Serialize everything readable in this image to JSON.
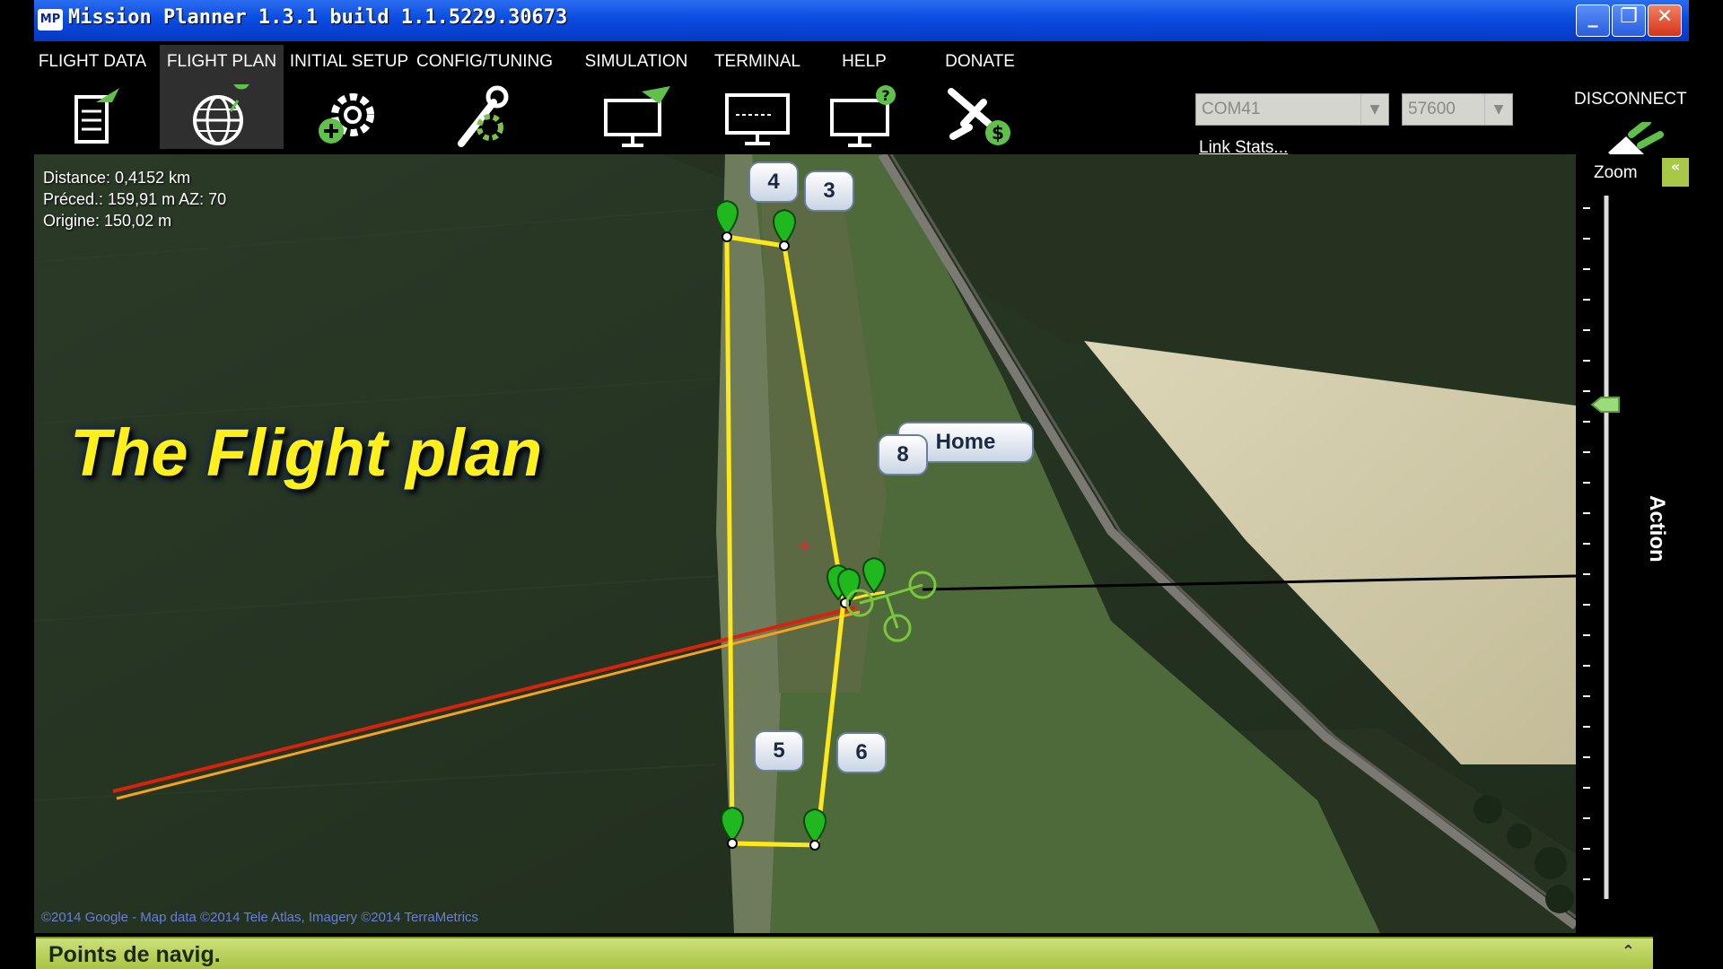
{
  "title_bar": {
    "app_icon_text": "MP",
    "title": "Mission Planner 1.3.1 build 1.1.5229.30673"
  },
  "menu": [
    {
      "label": "FLIGHT DATA",
      "icon": "clipboard-plane-icon",
      "active": false
    },
    {
      "label": "FLIGHT PLAN",
      "icon": "globe-pin-icon",
      "active": true
    },
    {
      "label": "INITIAL SETUP",
      "icon": "gear-plus-icon",
      "active": false
    },
    {
      "label": "CONFIG/TUNING",
      "icon": "wrench-gear-icon",
      "active": false
    },
    {
      "label": "SIMULATION",
      "icon": "monitor-plane-icon",
      "active": false
    },
    {
      "label": "TERMINAL",
      "icon": "terminal-monitor-icon",
      "active": false
    },
    {
      "label": "HELP",
      "icon": "monitor-help-icon",
      "active": false
    },
    {
      "label": "DONATE",
      "icon": "plane-dollar-icon",
      "active": false
    }
  ],
  "connection": {
    "port": "COM41",
    "baud": "57600",
    "link_stats": "Link Stats...",
    "disconnect": "DISCONNECT"
  },
  "map": {
    "distance": "Distance: 0,4152 km",
    "previous": "Préced.: 159,91 m AZ: 70",
    "home_dist": "Origine: 150,02 m",
    "overlay_title": "The Flight plan",
    "copyright": "©2014 Google - Map data ©2014 Tele Atlas, Imagery ©2014 TerraMetrics",
    "waypoint_labels": {
      "wp3": "3",
      "wp4": "4",
      "wp5": "5",
      "wp6": "6",
      "wp8": "8",
      "home": "Home"
    }
  },
  "zoom_panel": {
    "label": "Zoom",
    "action_tab": "Action",
    "collapse": "«"
  },
  "bottom_bar": {
    "title": "Points de navig.",
    "expand": "⌃"
  },
  "colors": {
    "title_bar": "#0a4ce0",
    "route": "#ffe81a",
    "bottom_bar": "#b4cc50",
    "marker": "#1fb81f"
  }
}
